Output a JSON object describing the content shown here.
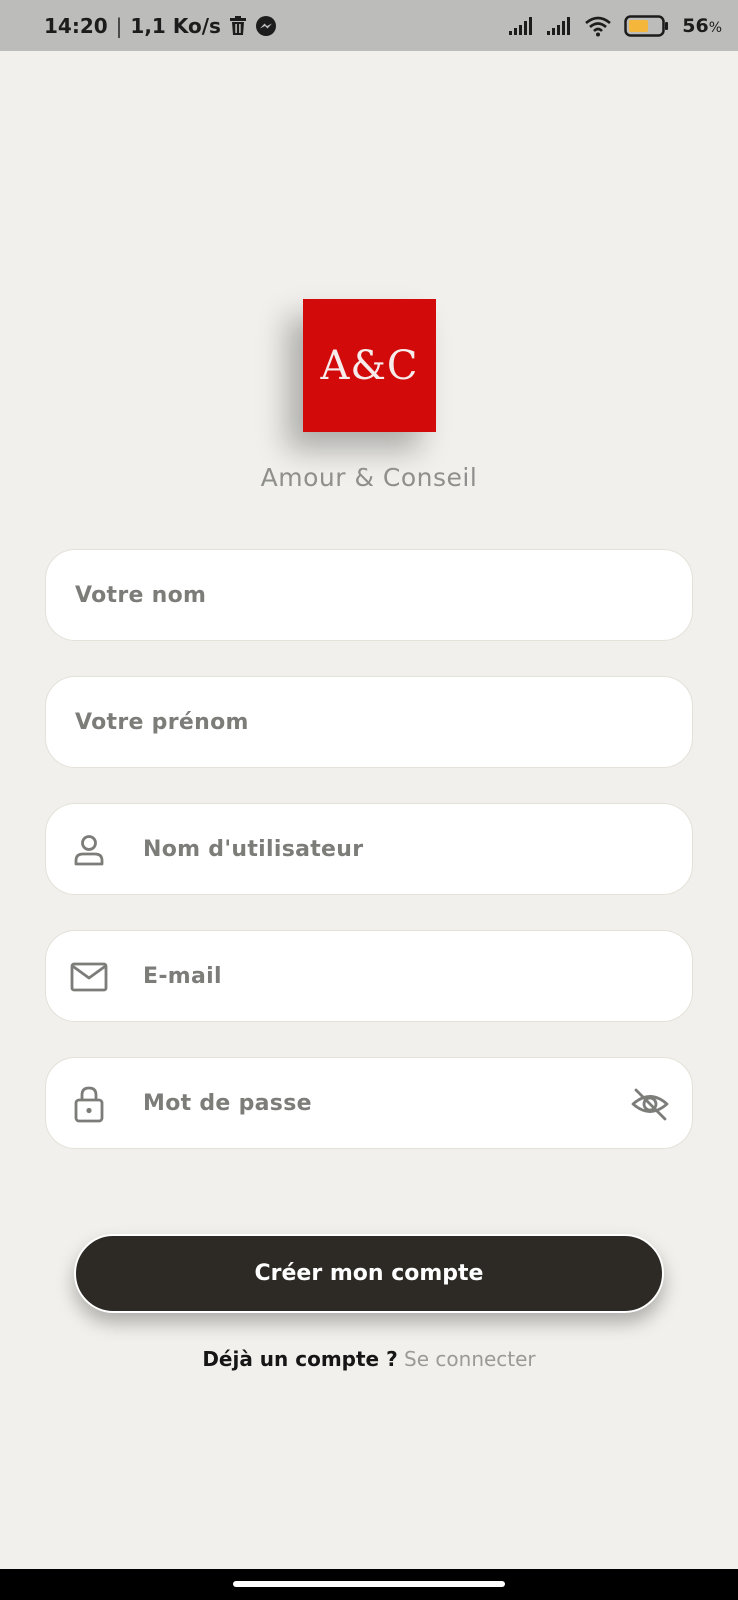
{
  "status_bar": {
    "time": "14:20",
    "separator": "|",
    "speed": "1,1 Ko/s",
    "battery_percent": "56",
    "battery_unit": "%",
    "battery_color": "#f4b73b",
    "icons": [
      "trash-icon",
      "messenger-icon",
      "signal-icon",
      "signal-icon",
      "wifi-icon",
      "battery-icon"
    ]
  },
  "logo": {
    "text": "A&C",
    "color": "#d30a0a"
  },
  "app_name": "Amour & Conseil",
  "form": {
    "last_name_placeholder": "Votre nom",
    "first_name_placeholder": "Votre prénom",
    "username_placeholder": "Nom d'utilisateur",
    "email_placeholder": "E-mail",
    "password_placeholder": "Mot de passe",
    "icons": {
      "username": "user-icon",
      "email": "mail-icon",
      "password": "lock-icon",
      "password_toggle": "eye-off-icon"
    }
  },
  "create_button_label": "Créer mon compte",
  "login": {
    "prompt": "Déjà un compte ?",
    "link": "Se connecter"
  }
}
